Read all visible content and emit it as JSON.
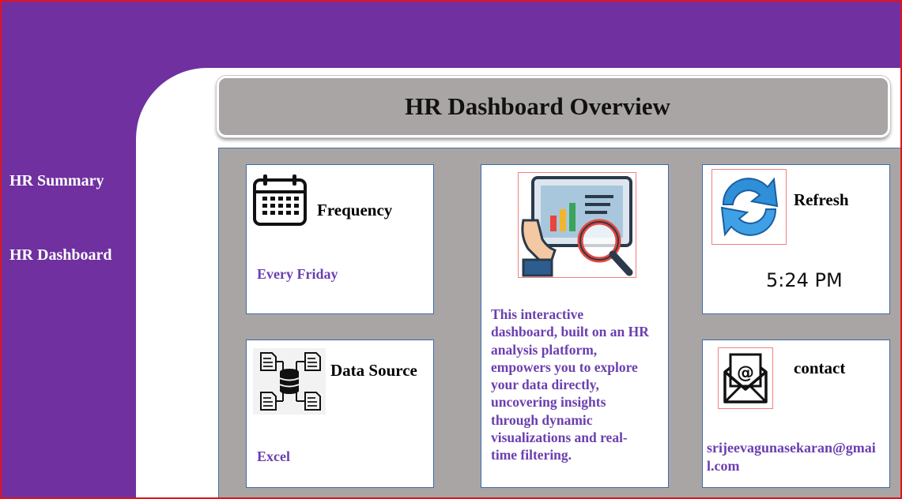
{
  "sidebar": {
    "items": [
      {
        "label": "HR Summary"
      },
      {
        "label": "HR Dashboard"
      }
    ]
  },
  "header": {
    "title": "HR Dashboard Overview"
  },
  "cards": {
    "frequency": {
      "title": "Frequency",
      "value": "Every Friday",
      "icon": "calendar-icon"
    },
    "data_source": {
      "title": "Data Source",
      "value": "Excel",
      "icon": "database-network-icon"
    },
    "description": {
      "text": "This interactive dashboard, built on an HR analysis platform, empowers you to explore your data directly, uncovering insights through dynamic visualizations and real-time filtering.",
      "icon": "analytics-magnifier-icon"
    },
    "refresh": {
      "title": "Refresh",
      "time": "5:24 PM",
      "icon": "refresh-arrows-icon"
    },
    "contact": {
      "title": "contact",
      "email": "srijeevagunasekaran@gmail.com",
      "icon": "email-envelope-icon"
    }
  },
  "colors": {
    "sidebar": "#7030a0",
    "panel": "#aaa5a5",
    "accent_text": "#6a3fb0",
    "card_border": "#3d6aa8"
  }
}
